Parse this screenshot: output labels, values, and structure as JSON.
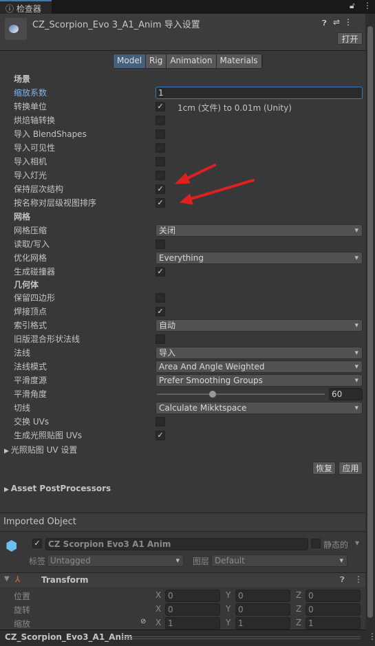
{
  "window": {
    "tab_label": "检查器"
  },
  "header": {
    "title": "CZ_Scorpion_Evo 3_A1_Anim 导入设置",
    "open_button": "打开"
  },
  "tabs": [
    "Model",
    "Rig",
    "Animation",
    "Materials"
  ],
  "active_tab": "Model",
  "sections": {
    "scene": "场景",
    "mesh": "网格",
    "geometry": "几何体"
  },
  "scene": {
    "scale_factor": {
      "label": "缩放系数",
      "value": "1"
    },
    "convert_units": {
      "label": "转换单位",
      "checked": true,
      "note": "1cm (文件) to 0.01m (Unity)"
    },
    "bake_axis": {
      "label": "烘焙轴转换",
      "checked": false
    },
    "blendshapes": {
      "label": "导入 BlendShapes",
      "checked": false
    },
    "visibility": {
      "label": "导入可见性",
      "checked": false
    },
    "cameras": {
      "label": "导入相机",
      "checked": false
    },
    "lights": {
      "label": "导入灯光",
      "checked": false
    },
    "preserve_hierarchy": {
      "label": "保持层次结构",
      "checked": true
    },
    "sort_by_name": {
      "label": "按名称对层级视图排序",
      "checked": true
    }
  },
  "mesh": {
    "compression": {
      "label": "网格压缩",
      "value": "关闭"
    },
    "read_write": {
      "label": "读取/写入",
      "checked": false
    },
    "optimize": {
      "label": "优化网格",
      "value": "Everything"
    },
    "colliders": {
      "label": "生成碰撞器",
      "checked": true
    }
  },
  "geometry": {
    "keep_quads": {
      "label": "保留四边形",
      "checked": false
    },
    "weld": {
      "label": "焊接顶点",
      "checked": true
    },
    "index_format": {
      "label": "索引格式",
      "value": "自动"
    },
    "legacy_blend": {
      "label": "旧版混合形状法线",
      "checked": false
    },
    "normals": {
      "label": "法线",
      "value": "导入"
    },
    "normals_mode": {
      "label": "法线模式",
      "value": "Area And Angle Weighted"
    },
    "smoothness_source": {
      "label": "平滑度源",
      "value": "Prefer Smoothing Groups"
    },
    "smoothing_angle": {
      "label": "平滑角度",
      "value": "60",
      "min": 0,
      "max": 180
    },
    "tangents": {
      "label": "切线",
      "value": "Calculate Mikktspace"
    },
    "swap_uvs": {
      "label": "交换 UVs",
      "checked": false
    },
    "lightmap_uvs": {
      "label": "生成光照贴图 UVs",
      "checked": true
    }
  },
  "lightmap_settings": "光照贴图 UV 设置",
  "revert": "恢复",
  "apply": "应用",
  "postprocessors": "Asset PostProcessors",
  "imported": {
    "title": "Imported Object",
    "name": "CZ Scorpion Evo3 A1 Anim",
    "static": "静态的",
    "tag_label": "标签",
    "tag": "Untagged",
    "layer_label": "图层",
    "layer": "Default"
  },
  "transform": {
    "title": "Transform",
    "position": {
      "label": "位置",
      "x": "0",
      "y": "0",
      "z": "0"
    },
    "rotation": {
      "label": "旋转",
      "x": "0",
      "y": "0",
      "z": "0"
    },
    "scale": {
      "label": "缩放",
      "x": "1",
      "y": "1",
      "z": "1"
    }
  },
  "footer": "CZ_Scorpion_Evo3_A1_Anim",
  "accent": "#3a79bb",
  "arrow_color": "#e02020"
}
